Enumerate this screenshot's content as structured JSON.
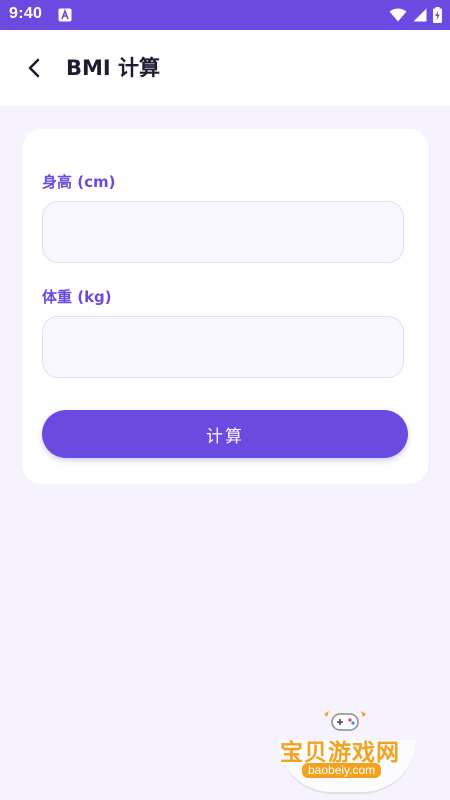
{
  "status_bar": {
    "time": "9:40",
    "icons": [
      "app-notification-icon",
      "wifi-icon",
      "signal-icon",
      "battery-charging-icon"
    ]
  },
  "app_bar": {
    "title": "BMI 计算",
    "back_icon": "chevron-left-icon"
  },
  "form": {
    "height_label": "身高 (cm)",
    "height_value": "",
    "weight_label": "体重 (kg)",
    "weight_value": "",
    "calculate_label": "计算"
  },
  "watermark": {
    "brand": "宝贝游戏网",
    "url": "baobeiy.com"
  },
  "colors": {
    "accent": "#6a4ae0",
    "background": "#f6f3ff",
    "card": "#ffffff",
    "title": "#1e1b33",
    "watermark": "#f2a21e"
  }
}
